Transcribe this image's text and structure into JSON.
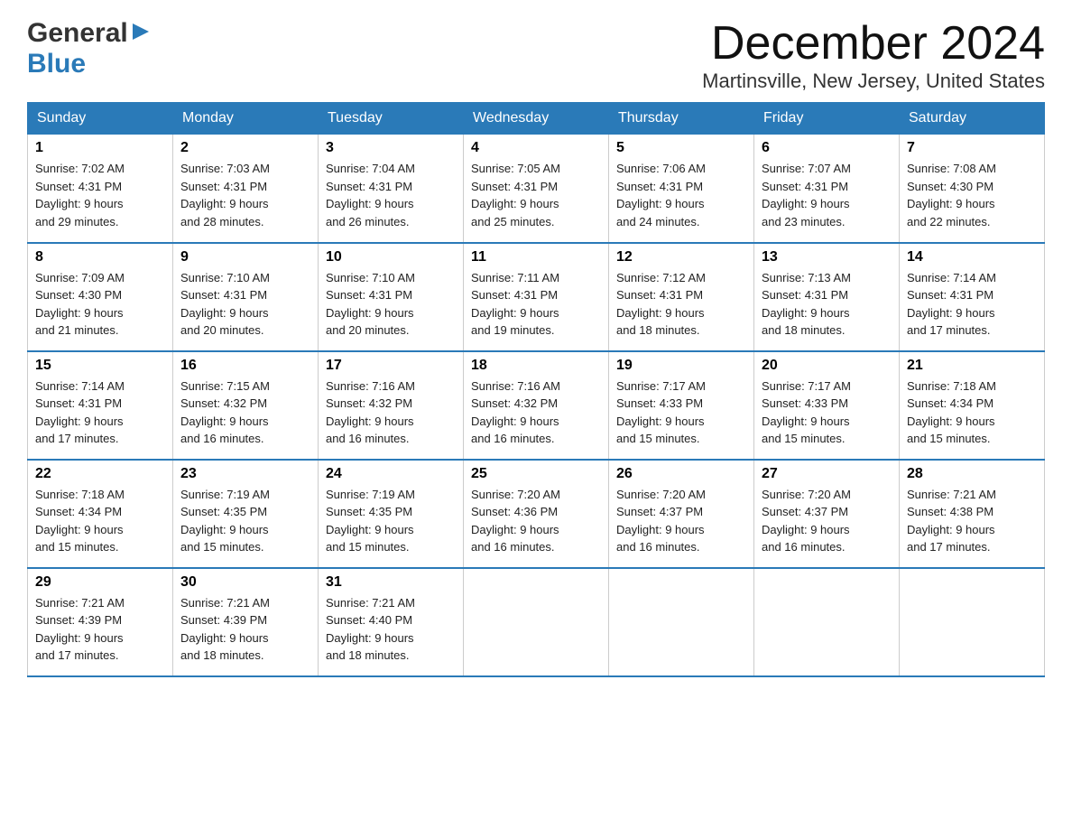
{
  "logo": {
    "general": "General",
    "blue": "Blue"
  },
  "title": {
    "month_year": "December 2024",
    "location": "Martinsville, New Jersey, United States"
  },
  "weekdays": [
    "Sunday",
    "Monday",
    "Tuesday",
    "Wednesday",
    "Thursday",
    "Friday",
    "Saturday"
  ],
  "weeks": [
    [
      {
        "day": "1",
        "sunrise": "7:02 AM",
        "sunset": "4:31 PM",
        "daylight": "9 hours and 29 minutes."
      },
      {
        "day": "2",
        "sunrise": "7:03 AM",
        "sunset": "4:31 PM",
        "daylight": "9 hours and 28 minutes."
      },
      {
        "day": "3",
        "sunrise": "7:04 AM",
        "sunset": "4:31 PM",
        "daylight": "9 hours and 26 minutes."
      },
      {
        "day": "4",
        "sunrise": "7:05 AM",
        "sunset": "4:31 PM",
        "daylight": "9 hours and 25 minutes."
      },
      {
        "day": "5",
        "sunrise": "7:06 AM",
        "sunset": "4:31 PM",
        "daylight": "9 hours and 24 minutes."
      },
      {
        "day": "6",
        "sunrise": "7:07 AM",
        "sunset": "4:31 PM",
        "daylight": "9 hours and 23 minutes."
      },
      {
        "day": "7",
        "sunrise": "7:08 AM",
        "sunset": "4:30 PM",
        "daylight": "9 hours and 22 minutes."
      }
    ],
    [
      {
        "day": "8",
        "sunrise": "7:09 AM",
        "sunset": "4:30 PM",
        "daylight": "9 hours and 21 minutes."
      },
      {
        "day": "9",
        "sunrise": "7:10 AM",
        "sunset": "4:31 PM",
        "daylight": "9 hours and 20 minutes."
      },
      {
        "day": "10",
        "sunrise": "7:10 AM",
        "sunset": "4:31 PM",
        "daylight": "9 hours and 20 minutes."
      },
      {
        "day": "11",
        "sunrise": "7:11 AM",
        "sunset": "4:31 PM",
        "daylight": "9 hours and 19 minutes."
      },
      {
        "day": "12",
        "sunrise": "7:12 AM",
        "sunset": "4:31 PM",
        "daylight": "9 hours and 18 minutes."
      },
      {
        "day": "13",
        "sunrise": "7:13 AM",
        "sunset": "4:31 PM",
        "daylight": "9 hours and 18 minutes."
      },
      {
        "day": "14",
        "sunrise": "7:14 AM",
        "sunset": "4:31 PM",
        "daylight": "9 hours and 17 minutes."
      }
    ],
    [
      {
        "day": "15",
        "sunrise": "7:14 AM",
        "sunset": "4:31 PM",
        "daylight": "9 hours and 17 minutes."
      },
      {
        "day": "16",
        "sunrise": "7:15 AM",
        "sunset": "4:32 PM",
        "daylight": "9 hours and 16 minutes."
      },
      {
        "day": "17",
        "sunrise": "7:16 AM",
        "sunset": "4:32 PM",
        "daylight": "9 hours and 16 minutes."
      },
      {
        "day": "18",
        "sunrise": "7:16 AM",
        "sunset": "4:32 PM",
        "daylight": "9 hours and 16 minutes."
      },
      {
        "day": "19",
        "sunrise": "7:17 AM",
        "sunset": "4:33 PM",
        "daylight": "9 hours and 15 minutes."
      },
      {
        "day": "20",
        "sunrise": "7:17 AM",
        "sunset": "4:33 PM",
        "daylight": "9 hours and 15 minutes."
      },
      {
        "day": "21",
        "sunrise": "7:18 AM",
        "sunset": "4:34 PM",
        "daylight": "9 hours and 15 minutes."
      }
    ],
    [
      {
        "day": "22",
        "sunrise": "7:18 AM",
        "sunset": "4:34 PM",
        "daylight": "9 hours and 15 minutes."
      },
      {
        "day": "23",
        "sunrise": "7:19 AM",
        "sunset": "4:35 PM",
        "daylight": "9 hours and 15 minutes."
      },
      {
        "day": "24",
        "sunrise": "7:19 AM",
        "sunset": "4:35 PM",
        "daylight": "9 hours and 15 minutes."
      },
      {
        "day": "25",
        "sunrise": "7:20 AM",
        "sunset": "4:36 PM",
        "daylight": "9 hours and 16 minutes."
      },
      {
        "day": "26",
        "sunrise": "7:20 AM",
        "sunset": "4:37 PM",
        "daylight": "9 hours and 16 minutes."
      },
      {
        "day": "27",
        "sunrise": "7:20 AM",
        "sunset": "4:37 PM",
        "daylight": "9 hours and 16 minutes."
      },
      {
        "day": "28",
        "sunrise": "7:21 AM",
        "sunset": "4:38 PM",
        "daylight": "9 hours and 17 minutes."
      }
    ],
    [
      {
        "day": "29",
        "sunrise": "7:21 AM",
        "sunset": "4:39 PM",
        "daylight": "9 hours and 17 minutes."
      },
      {
        "day": "30",
        "sunrise": "7:21 AM",
        "sunset": "4:39 PM",
        "daylight": "9 hours and 18 minutes."
      },
      {
        "day": "31",
        "sunrise": "7:21 AM",
        "sunset": "4:40 PM",
        "daylight": "9 hours and 18 minutes."
      },
      null,
      null,
      null,
      null
    ]
  ]
}
